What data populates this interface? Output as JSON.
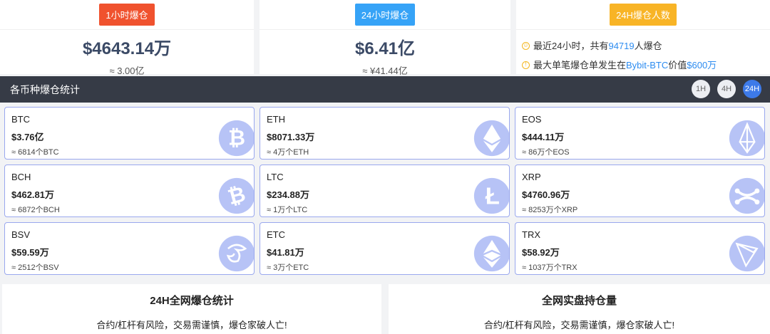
{
  "summary": {
    "h1": {
      "tag": "1小时爆仓",
      "amount": "$4643.14万",
      "approx": "≈ 3.00亿",
      "color": "#f0522e"
    },
    "h24": {
      "tag": "24小时爆仓",
      "amount": "$6.41亿",
      "approx": "≈ ¥41.44亿",
      "color": "#36a3f7"
    },
    "people": {
      "tag": "24H爆仓人数",
      "color": "#f8b426",
      "line1_pre": "最近24小时，共有",
      "line1_num": "94719",
      "line1_post": "人爆仓",
      "line2_pre": "最大单笔爆仓单发生在",
      "line2_sym": "Bybit-BTC",
      "line2_mid": "价值",
      "line2_val": "$600万"
    }
  },
  "section": {
    "title": "各币种爆仓统计",
    "buttons": [
      "1H",
      "4H",
      "24H"
    ],
    "active": "24H"
  },
  "coins": [
    {
      "name": "BTC",
      "value": "$3.76亿",
      "amount": "≈ 6814个BTC",
      "icon": "bitcoin-icon"
    },
    {
      "name": "ETH",
      "value": "$8071.33万",
      "amount": "≈ 4万个ETH",
      "icon": "ethereum-icon"
    },
    {
      "name": "EOS",
      "value": "$444.11万",
      "amount": "≈ 86万个EOS",
      "icon": "eos-icon"
    },
    {
      "name": "BCH",
      "value": "$462.81万",
      "amount": "≈ 6872个BCH",
      "icon": "bitcoin-cash-icon"
    },
    {
      "name": "LTC",
      "value": "$234.88万",
      "amount": "≈ 1万个LTC",
      "icon": "litecoin-icon"
    },
    {
      "name": "XRP",
      "value": "$4760.96万",
      "amount": "≈ 8253万个XRP",
      "icon": "ripple-icon"
    },
    {
      "name": "BSV",
      "value": "$59.59万",
      "amount": "≈ 2512个BSV",
      "icon": "bsv-icon"
    },
    {
      "name": "ETC",
      "value": "$41.81万",
      "amount": "≈ 3万个ETC",
      "icon": "ethereum-classic-icon"
    },
    {
      "name": "TRX",
      "value": "$58.92万",
      "amount": "≈ 1037万个TRX",
      "icon": "tron-icon"
    }
  ],
  "panels": [
    {
      "title": "24H全网爆仓统计",
      "text": "合约/杠杆有风险，交易需谨慎，爆仓家破人亡!"
    },
    {
      "title": "全网实盘持仓量",
      "text": "合约/杠杆有风险，交易需谨慎，爆仓家破人亡!"
    }
  ]
}
